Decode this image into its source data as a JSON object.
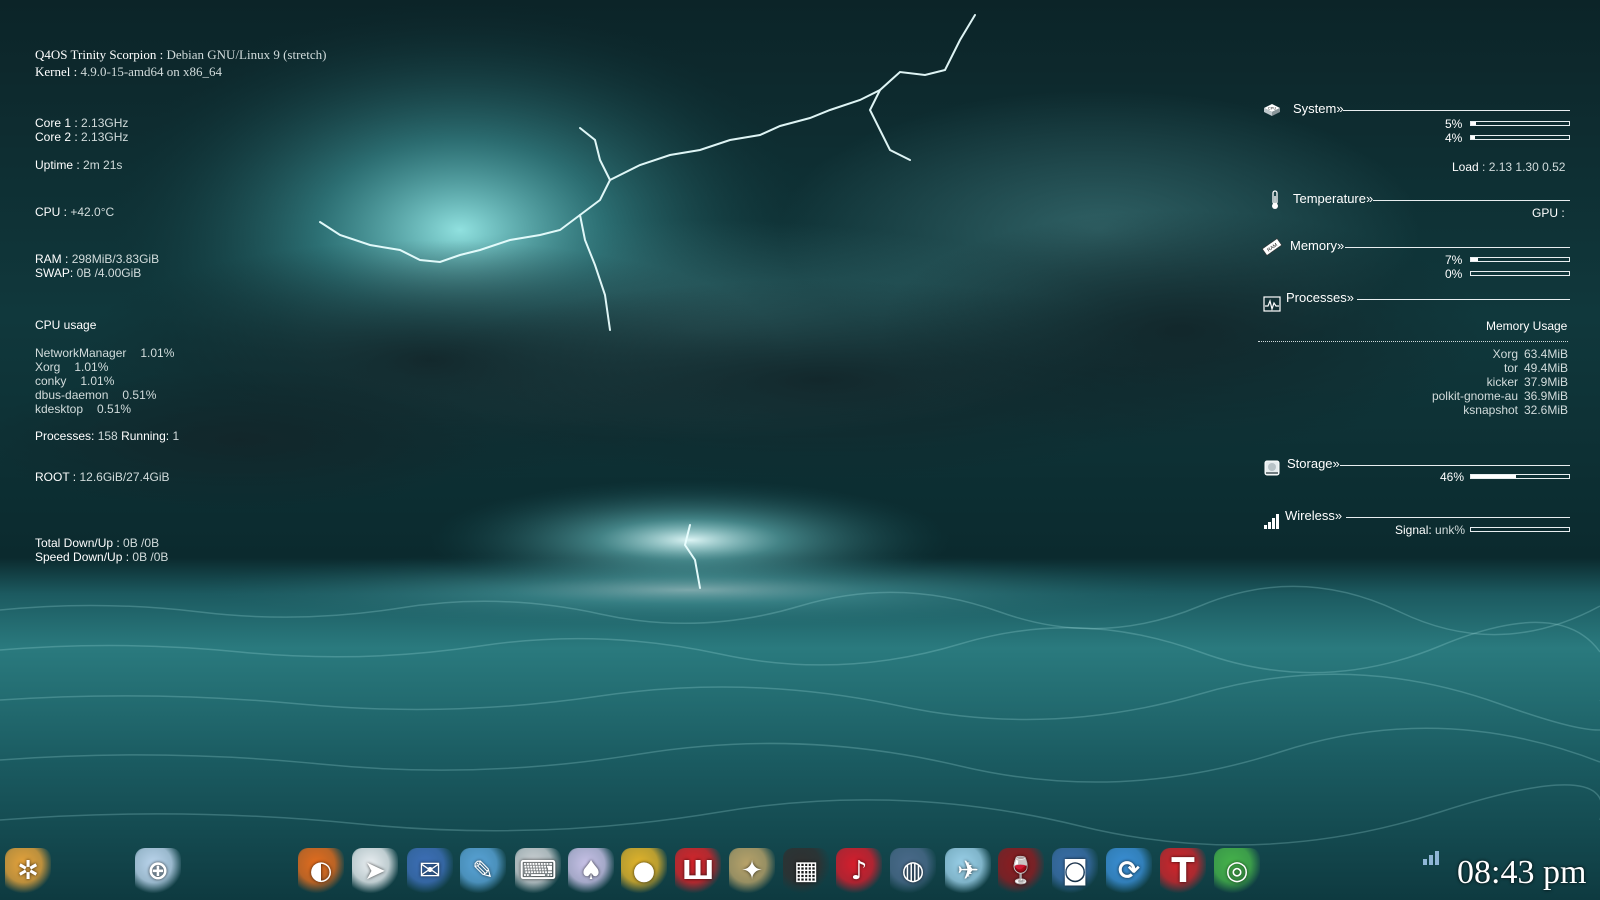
{
  "left_panel": {
    "os_label": "Q4OS Trinity Scorpion :",
    "os_value": "Debian GNU/Linux 9 (stretch)",
    "kernel_label": "Kernel :",
    "kernel_value": "4.9.0-15-amd64 on x86_64",
    "core1_label": "Core 1 :",
    "core1_value": "2.13GHz",
    "core2_label": "Core 2 :",
    "core2_value": "2.13GHz",
    "uptime_label": "Uptime :",
    "uptime_value": "2m 21s",
    "cpu_label": "CPU :",
    "cpu_value": "+42.0°C",
    "ram_label": "RAM :",
    "ram_value": "298MiB/3.83GiB",
    "swap_label": "SWAP:",
    "swap_value": "0B  /4.00GiB",
    "cpu_usage_title": "CPU usage",
    "cpu_processes": [
      {
        "name": "NetworkManager",
        "value": "1.01%"
      },
      {
        "name": "Xorg",
        "value": "1.01%"
      },
      {
        "name": "conky",
        "value": "1.01%"
      },
      {
        "name": "dbus-daemon",
        "value": "0.51%"
      },
      {
        "name": "kdesktop",
        "value": "0.51%"
      }
    ],
    "processes_label": "Processes:",
    "processes_value": "158",
    "running_label": "Running:",
    "running_value": "1",
    "root_label": "ROOT :",
    "root_value": "12.6GiB/27.4GiB",
    "total_label": "Total Down/Up :",
    "total_value": "0B  /0B",
    "speed_label": "Speed Down/Up :",
    "speed_value": "0B  /0B"
  },
  "right_panel": {
    "system_title": "System»",
    "cpu1_pct_text": "5%",
    "cpu1_level": 0.05,
    "cpu2_pct_text": "4%",
    "cpu2_level": 0.04,
    "load_label": "Load",
    "load_value": ": 2.13 1.30 0.52",
    "temperature_title": "Temperature»",
    "gpu_label": "GPU :",
    "memory_title": "Memory»",
    "ram_pct_text": "7%",
    "ram_level": 0.07,
    "swap_pct_text": "0%",
    "swap_level": 0.0,
    "processes_title": "Processes»",
    "memory_usage_title": "Memory Usage",
    "mem_processes": [
      {
        "name": "Xorg",
        "value": "63.4MiB"
      },
      {
        "name": "tor",
        "value": "49.4MiB"
      },
      {
        "name": "kicker",
        "value": "37.9MiB"
      },
      {
        "name": "polkit-gnome-au",
        "value": "36.9MiB"
      },
      {
        "name": "ksnapshot",
        "value": "32.6MiB"
      }
    ],
    "storage_title": "Storage»",
    "storage_pct_text": "46%",
    "storage_level": 0.46,
    "wireless_title": "Wireless»",
    "signal_label": "Signal:",
    "signal_value": "unk%",
    "signal_level": 0.0
  },
  "taskbar": {
    "clock": "08:43 pm",
    "launchers": [
      {
        "icon": "kde-menu-icon",
        "color": "#e7a33a"
      },
      {
        "icon": "search-globe-icon",
        "color": "#bcd6ee"
      },
      {
        "icon": "firefox-icon",
        "color": "#e46c1d"
      },
      {
        "icon": "paper-plane-icon",
        "color": "#eaeff2"
      },
      {
        "icon": "thunderbird-icon",
        "color": "#3d6fb8"
      },
      {
        "icon": "pen-icon",
        "color": "#59a4d8"
      },
      {
        "icon": "typewriter-icon",
        "color": "#cfd3d6"
      },
      {
        "icon": "playing-cards-icon",
        "color": "#c9c2e8"
      },
      {
        "icon": "pinball-icon",
        "color": "#e3b42a"
      },
      {
        "icon": "atari-icon",
        "color": "#d8242a"
      },
      {
        "icon": "lunar-lander-icon",
        "color": "#b9a36a"
      },
      {
        "icon": "clapperboard-icon",
        "color": "#303030"
      },
      {
        "icon": "music-note-icon",
        "color": "#d61d2c"
      },
      {
        "icon": "diver-icon",
        "color": "#4a6a8a"
      },
      {
        "icon": "airplane-globe-icon",
        "color": "#9bd1ea"
      },
      {
        "icon": "wine-glass-icon",
        "color": "#8e1b1f"
      },
      {
        "icon": "camera-icon",
        "color": "#3a6ea8"
      },
      {
        "icon": "update-arrows-icon",
        "color": "#3a8fd6"
      },
      {
        "icon": "fonts-icon",
        "color": "#d0242a"
      },
      {
        "icon": "speaker-icon",
        "color": "#46b34a"
      }
    ]
  }
}
